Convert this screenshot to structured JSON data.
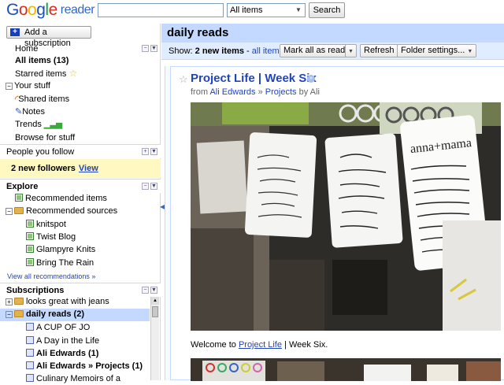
{
  "header": {
    "logo_google": "Google",
    "logo_reader": "reader",
    "search_value": "",
    "filter_selected": "All items",
    "search_button": "Search"
  },
  "sidebar": {
    "add_subscription": "Add a subscription",
    "home": "Home",
    "all_items": "All items (13)",
    "starred_items": "Starred items",
    "your_stuff": "Your stuff",
    "shared_items": "Shared items",
    "notes": "Notes",
    "trends": "Trends",
    "browse": "Browse for stuff",
    "people_header": "People you follow",
    "followers_text": "2 new followers",
    "followers_link": "View",
    "explore_header": "Explore",
    "recommended_items": "Recommended items",
    "recommended_sources": "Recommended sources",
    "sources": [
      "knitspot",
      "Twist Blog",
      "Glampyre Knits",
      "Bring The Rain"
    ],
    "view_all": "View all recommendations »",
    "subscriptions_header": "Subscriptions",
    "folders": [
      {
        "label": "looks great with jeans",
        "bold": false,
        "selected": false
      },
      {
        "label": "daily reads (2)",
        "bold": true,
        "selected": true
      }
    ],
    "feeds": [
      {
        "label": "A CUP OF JO",
        "bold": false
      },
      {
        "label": "A Day in the Life",
        "bold": false
      },
      {
        "label": "Ali Edwards (1)",
        "bold": true
      },
      {
        "label": "Ali Edwards » Projects (1)",
        "bold": true
      },
      {
        "label": "Culinary Memoirs of a",
        "bold": false
      }
    ]
  },
  "main": {
    "title": "daily reads",
    "show_label": "Show:",
    "new_items": "2 new items",
    "all_items_link": "all items",
    "mark_all_read": "Mark all as read",
    "refresh": "Refresh",
    "folder_settings": "Folder settings..."
  },
  "entry": {
    "title": "Project Life | Week Six",
    "from_prefix": "from",
    "source": "Ali Edwards",
    "sep": "»",
    "category": "Projects",
    "by": "by Ali",
    "body_prefix": "Welcome to",
    "body_link": "Project Life",
    "body_suffix": "| Week Six."
  },
  "colors": {
    "accent": "#c3d9ff",
    "link": "#2244bb",
    "followers_bg": "#fff8c0"
  }
}
